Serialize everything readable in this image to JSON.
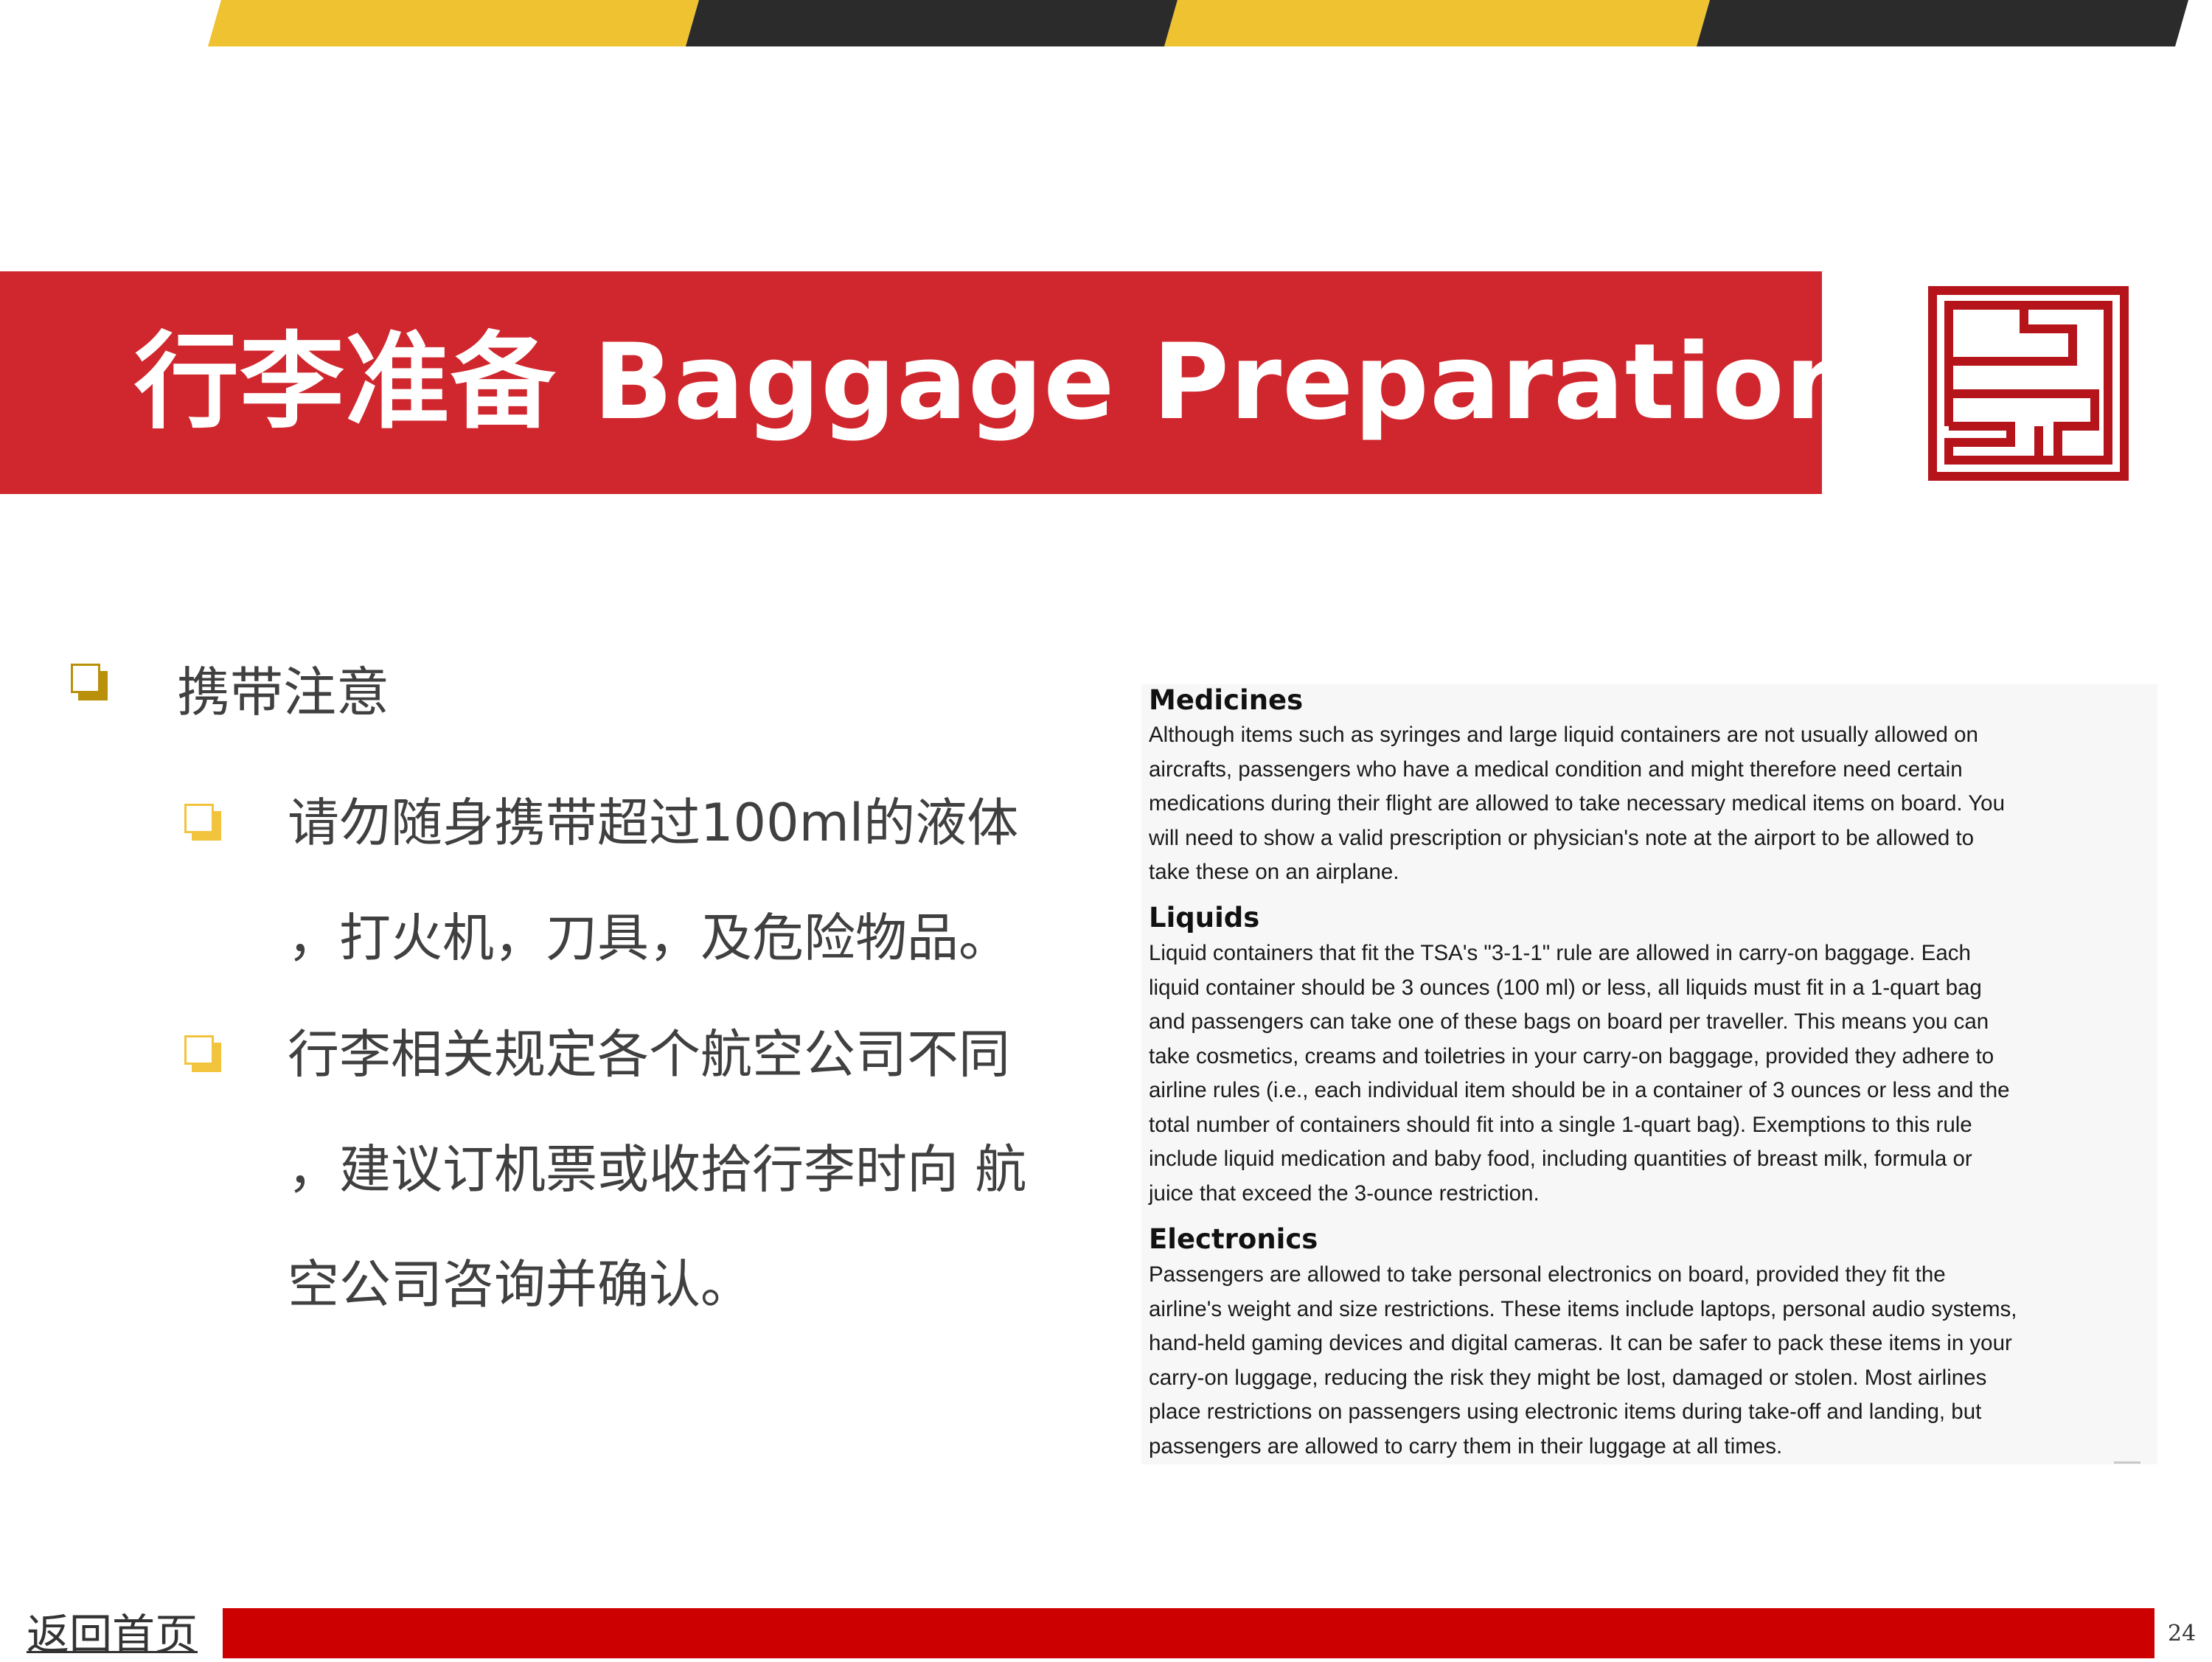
{
  "title": "行李准备 Baggage Preparation",
  "main_bullet": "携带注意",
  "sub_bullets": [
    {
      "lines": [
        "请勿随身携带超过100ml的液体",
        "，打火机，刀具，及危险物品。"
      ]
    },
    {
      "lines": [
        "行李相关规定各个航空公司不同",
        "，建议订机票或收拾行李时向 航",
        "空公司咨询并确认。"
      ]
    }
  ],
  "info_panel": {
    "sections": [
      {
        "heading": "Medicines",
        "lines": [
          "Although items such as syringes and large liquid containers are not usually allowed on",
          "aircrafts, passengers who have a medical condition and might therefore need certain",
          "medications during their flight are allowed to take necessary medical items on board. You",
          "will need to show a valid prescription or physician's note at the airport to be allowed to",
          "take these on an airplane."
        ]
      },
      {
        "heading": "Liquids",
        "lines": [
          "Liquid containers that fit the TSA's \"3-1-1\" rule are allowed in carry-on baggage. Each",
          "liquid container should be 3 ounces (100 ml) or less, all liquids must fit in a 1-quart bag",
          "and passengers can take one of these bags on board per traveller. This means you can",
          "take cosmetics, creams and toiletries in your carry-on baggage, provided they adhere to",
          "airline rules (i.e., each individual item should be in a container of 3 ounces or less and the",
          "total number of containers should fit into a single 1-quart bag). Exemptions to this rule",
          "include liquid medication and baby food, including quantities of breast milk, formula or",
          "juice that exceed the 3-ounce restriction."
        ]
      },
      {
        "heading": "Electronics",
        "lines": [
          "Passengers are allowed to take personal electronics on board, provided they fit the",
          "airline's weight and size restrictions. These items include laptops, personal audio systems,",
          "hand-held gaming devices and digital cameras. It can be safer to pack these items in your",
          "carry-on luggage, reducing the risk they might be lost, damaged or stolen. Most airlines",
          "place restrictions on passengers using electronic items during take-off and landing, but",
          "passengers are allowed to carry them in their luggage at all times."
        ]
      }
    ]
  },
  "footer": {
    "home_link": "返回首页",
    "page_number": "24"
  },
  "colors": {
    "banner_red": "#d0272e",
    "stripe_yellow": "#efc232",
    "stripe_dark": "#2b2b2b",
    "footer_red": "#cc0000",
    "bullet_gold": "#b8900a",
    "bullet_light": "#f2c43d",
    "logo_red": "#b5141b"
  }
}
